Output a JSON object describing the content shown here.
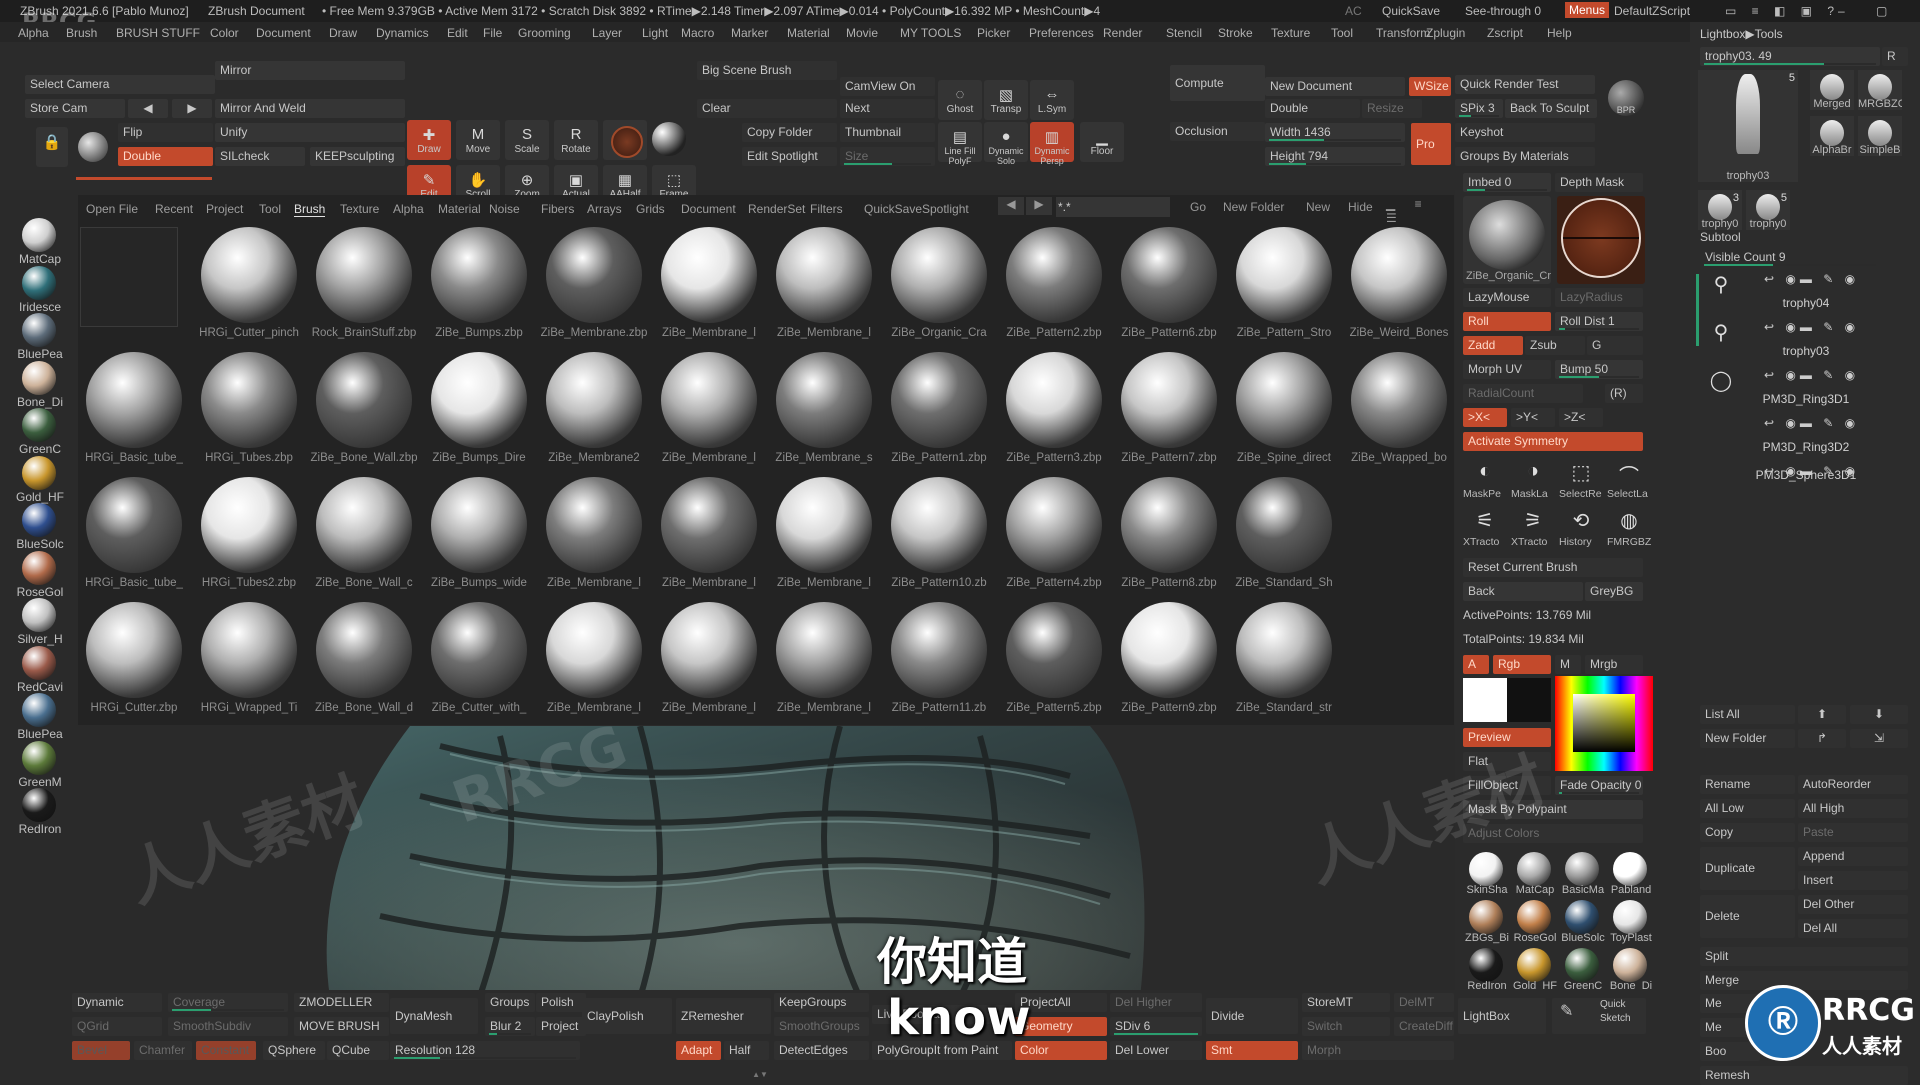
{
  "titlebar": {
    "app": "ZBrush 2021.6.6 [Pablo Munoz]",
    "doc": "ZBrush Document",
    "stats": "• Free Mem 9.379GB • Active Mem 3172 • Scratch Disk 3892 • RTime▶2.148 Timer▶2.097 ATime▶0.014 • PolyCount▶16.392 MP • MeshCount▶4",
    "ac": "AC",
    "quicksave": "QuickSave",
    "seethrough": "See-through  0",
    "menus": "Menus",
    "script": "DefaultZScript",
    "watermark": "RRCG"
  },
  "menubar": [
    "Alpha",
    "Brush",
    "BRUSH STUFF",
    "Color",
    "Document",
    "Draw",
    "Dynamics",
    "Edit",
    "File",
    "Grooming",
    "Layer",
    "Light",
    "Macro",
    "Marker",
    "Material",
    "Movie",
    "MY TOOLS",
    "Picker",
    "Preferences",
    "Render",
    "Stencil",
    "Stroke",
    "Texture",
    "Tool",
    "Transform",
    "Zplugin",
    "Zscript",
    "Help"
  ],
  "shelf": {
    "select_camera": "Select Camera",
    "store_cam": "Store Cam",
    "flip": "Flip",
    "double": "Double",
    "mirror": "Mirror",
    "mirror_weld": "Mirror And Weld",
    "unify": "Unify",
    "silcheck": "SILcheck",
    "keepsculpting": "KEEPsculpting",
    "big_scene_brush": "Big Scene Brush",
    "clear": "Clear",
    "copy_folder": "Copy Folder",
    "edit_spotlight": "Edit Spotlight",
    "camview_on": "CamView On",
    "next": "Next",
    "thumbnail": "Thumbnail",
    "size": "Size",
    "compute": "Compute",
    "occlusion": "Occlusion",
    "new_document": "New Document",
    "wsize": "WSize",
    "doc_double": "Double",
    "resize": "Resize",
    "width": "Width 1436",
    "height": "Height 794",
    "pro": "Pro",
    "quick_render": "Quick Render Test",
    "spix": "SPix 3",
    "back_to_sculpt": "Back To Sculpt",
    "bpr": "BPR",
    "keyshot": "Keyshot",
    "groups_by_materials": "Groups By Materials",
    "tools": [
      {
        "label": "Draw",
        "icon": "✚"
      },
      {
        "label": "Move",
        "icon": "M"
      },
      {
        "label": "Scale",
        "icon": "S"
      },
      {
        "label": "Rotate",
        "icon": "R"
      },
      {
        "label": "Edit",
        "icon": "✎"
      },
      {
        "label": "Scroll",
        "icon": "✋"
      },
      {
        "label": "Zoom",
        "icon": "⊕"
      },
      {
        "label": "Actual",
        "icon": "▣"
      },
      {
        "label": "AAHalf",
        "icon": "▦"
      },
      {
        "label": "Frame",
        "icon": "⬚"
      },
      {
        "label": "Ghost",
        "icon": "◌"
      },
      {
        "label": "Transp",
        "icon": "▧"
      },
      {
        "label": "L.Sym",
        "icon": "⇔"
      },
      {
        "label": "Line Fill PolyF",
        "icon": "▤"
      },
      {
        "label": "Dynamic Solo",
        "icon": "●"
      },
      {
        "label": "Dynamic Persp",
        "icon": "▥"
      },
      {
        "label": "Floor",
        "icon": "▁"
      }
    ]
  },
  "palette": {
    "tabs": [
      "Open File",
      "Recent",
      "Project",
      "Tool",
      "Brush",
      "Texture",
      "Alpha",
      "Material",
      "Noise",
      "Fibers",
      "Arrays",
      "Grids",
      "Document",
      "RenderSet",
      "Filters",
      "QuickSave",
      "Spotlight"
    ],
    "active_tab": "Brush",
    "search_value": "*.*",
    "go": "Go",
    "new_folder": "New Folder",
    "new": "New",
    "hide": "Hide",
    "brushes": [
      "",
      "HRGi_Cutter_pinch",
      "Rock_BrainStuff.zbp",
      "ZiBe_Bumps.zbp",
      "ZiBe_Membrane.zbp",
      "ZiBe_Membrane_l",
      "ZiBe_Membrane_l",
      "ZiBe_Organic_Cra",
      "ZiBe_Pattern2.zbp",
      "ZiBe_Pattern6.zbp",
      "ZiBe_Pattern_Stro",
      "ZiBe_Weird_Bones",
      "HRGi_Basic_tube_",
      "HRGi_Tubes.zbp",
      "ZiBe_Bone_Wall.zbp",
      "ZiBe_Bumps_Dire",
      "ZiBe_Membrane2",
      "ZiBe_Membrane_l",
      "ZiBe_Membrane_s",
      "ZiBe_Pattern1.zbp",
      "ZiBe_Pattern3.zbp",
      "ZiBe_Pattern7.zbp",
      "ZiBe_Spine_direct",
      "ZiBe_Wrapped_bo",
      "HRGi_Basic_tube_",
      "HRGi_Tubes2.zbp",
      "ZiBe_Bone_Wall_c",
      "ZiBe_Bumps_wide",
      "ZiBe_Membrane_l",
      "ZiBe_Membrane_l",
      "ZiBe_Membrane_l",
      "ZiBe_Pattern10.zb",
      "ZiBe_Pattern4.zbp",
      "ZiBe_Pattern8.zbp",
      "ZiBe_Standard_Sh",
      "",
      "HRGi_Cutter.zbp",
      "HRGi_Wrapped_Ti",
      "ZiBe_Bone_Wall_d",
      "ZiBe_Cutter_with_",
      "ZiBe_Membrane_l",
      "ZiBe_Membrane_l",
      "ZiBe_Membrane_l",
      "ZiBe_Pattern11.zb",
      "ZiBe_Pattern5.zbp",
      "ZiBe_Pattern9.zbp",
      "ZiBe_Standard_str",
      ""
    ]
  },
  "left_materials": [
    "MatCap",
    "Iridesce",
    "BluePea",
    "Bone_Di",
    "GreenC",
    "Gold_HF",
    "BlueSolc",
    "RoseGol",
    "Silver_H",
    "RedCavi",
    "BluePea",
    "GreenM",
    "RedIron"
  ],
  "right": {
    "imbed": "Imbed 0",
    "depth_mask": "Depth Mask",
    "brush_name": "ZiBe_Organic_Cr",
    "lazymouse": "LazyMouse",
    "lazyradius": "LazyRadius",
    "roll": "Roll",
    "roll_dist": "Roll Dist 1",
    "zadd": "Zadd",
    "zsub": "Zsub",
    "g": "G",
    "morph_uv": "Morph UV",
    "bump": "Bump 50",
    "radialcount": "RadialCount",
    "r": "(R)",
    "x": ">X<",
    "y": ">Y<",
    "z": ">Z<",
    "activate_symmetry": "Activate Symmetry",
    "icons1": [
      "MaskPe",
      "MaskLa",
      "SelectRe",
      "SelectLa"
    ],
    "icons2": [
      "XTracto",
      "XTracto",
      "History",
      "FMRGBZ"
    ],
    "reset_brush": "Reset Current Brush",
    "back": "Back",
    "greybg": "GreyBG",
    "active_points": "ActivePoints: 13.769 Mil",
    "total_points": "TotalPoints: 19.834 Mil",
    "a": "A",
    "rgb": "Rgb",
    "m": "M",
    "mrgb": "Mrgb",
    "preview": "Preview",
    "flat": "Flat",
    "fillobject": "FillObject",
    "fade_opacity": "Fade Opacity 0",
    "mask_by_polypaint": "Mask By Polypaint",
    "adjust_colors": "Adjust Colors",
    "mats": [
      "SkinSha",
      "MatCap",
      "BasicMa",
      "Pabland",
      "ZBGs_Bi",
      "RoseGol",
      "BlueSolc",
      "ToyPlast",
      "RedIron",
      "Gold_HF",
      "GreenC",
      "Bone_Di"
    ]
  },
  "lightbox": {
    "title": "Lightbox▶Tools",
    "tool_name": "trophy03. 49",
    "r": "R",
    "thumbs": [
      {
        "label": "trophy03",
        "count": "5"
      },
      {
        "label": "Merged",
        "count": ""
      },
      {
        "label": "MRGBZG",
        "count": ""
      },
      {
        "label": "AlphaBr",
        "count": ""
      },
      {
        "label": "SimpleB",
        "count": ""
      },
      {
        "label": "trophy0",
        "count": "3"
      },
      {
        "label": "trophy0",
        "count": "5"
      }
    ],
    "subtool": "Subtool",
    "visible_count": "Visible Count 9",
    "subtools": [
      "trophy04",
      "trophy03",
      "PM3D_Ring3D1",
      "PM3D_Ring3D2",
      "PM3D_Sphere3D1"
    ],
    "list_all": "List All",
    "new_folder": "New Folder",
    "rename": "Rename",
    "autoreorder": "AutoReorder",
    "all_low": "All Low",
    "all_high": "All High",
    "copy": "Copy",
    "paste": "Paste",
    "append": "Append",
    "duplicate": "Duplicate",
    "insert": "Insert",
    "del_other": "Del Other",
    "delete": "Delete",
    "del_all": "Del All",
    "split": "Split",
    "merge": "Merge",
    "remesh": "Remesh",
    "merge2": "Me",
    "merge3": "Me",
    "bool": "Boo"
  },
  "bottom": {
    "dynamic": "Dynamic",
    "coverage": "Coverage",
    "qgrid": "QGrid",
    "smoothsubdiv": "SmoothSubdiv",
    "bevel": "Bevel",
    "chamfer": "Chamfer",
    "constant": "Constant",
    "zmodeller": "ZMODELLER",
    "move_brush": "MOVE BRUSH",
    "qsphere": "QSphere",
    "qcube": "QCube",
    "dynamesh": "DynaMesh",
    "groups": "Groups",
    "polish": "Polish",
    "blur": "Blur 2",
    "project": "Project",
    "resolution": "Resolution 128",
    "claypolish": "ClayPolish",
    "zremesher": "ZRemesher",
    "adapt": "Adapt",
    "half": "Half",
    "keepgroups": "KeepGroups",
    "smoothgroups": "SmoothGroups",
    "detectedges": "DetectEdges",
    "livebool": "Live Boolean",
    "polygroupit": "PolyGroupIt from Paint",
    "projectall": "ProjectAll",
    "geometry": "Geometry",
    "color": "Color",
    "del_higher": "Del Higher",
    "sdiv": "SDiv 6",
    "del_lower": "Del Lower",
    "divide": "Divide",
    "smt": "Smt",
    "storemt": "StoreMT",
    "delmt": "DelMT",
    "switch": "Switch",
    "createdif": "CreateDiff",
    "morph": "Morph",
    "lightbox": "LightBox",
    "quick_sketch": "Quick Sketch"
  },
  "captions": {
    "chinese": "你知道",
    "english": "know"
  },
  "watermarks": {
    "cn": "人人素材",
    "en": "RRCG"
  },
  "colors": {
    "accent_orange": "#c34a2c",
    "slider_green": "#2b9e6f"
  }
}
